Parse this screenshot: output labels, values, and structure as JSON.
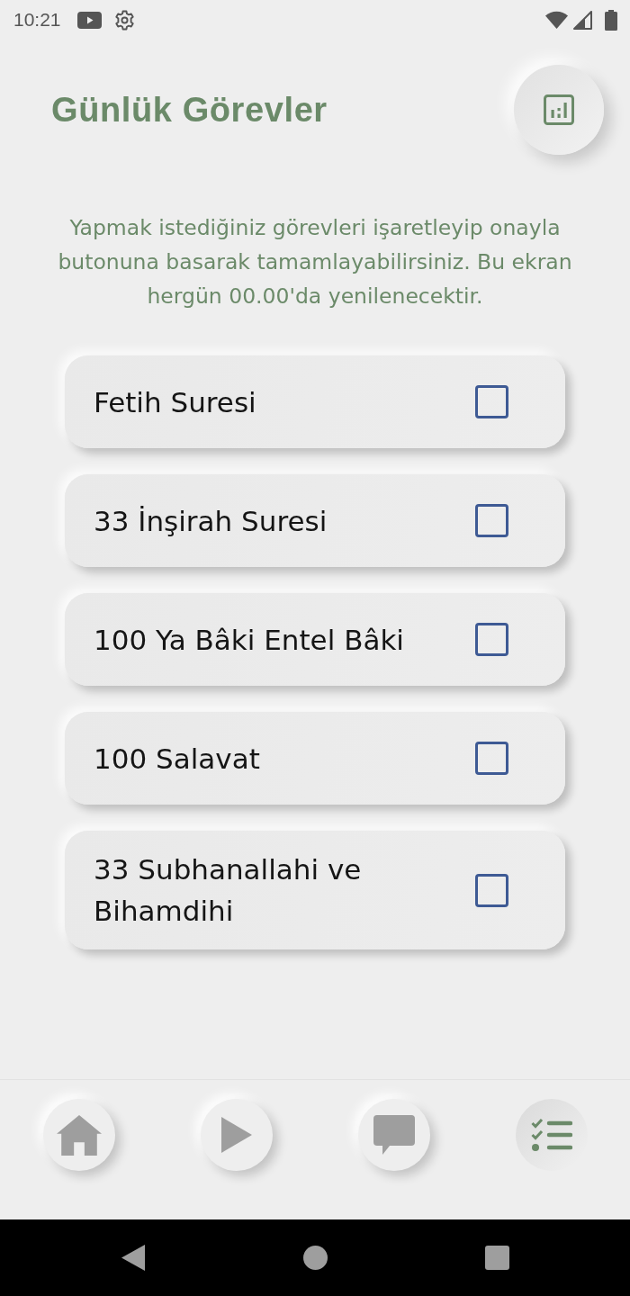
{
  "status_bar": {
    "time": "10:21"
  },
  "header": {
    "title": "Günlük Görevler"
  },
  "description": "Yapmak istediğiniz görevleri işaretleyip onayla butonuna basarak tamamlayabilirsiniz. Bu ekran hergün 00.00'da yenilenecektir.",
  "tasks": [
    {
      "label": "Fetih Suresi",
      "checked": false
    },
    {
      "label": "33 İnşirah Suresi",
      "checked": false
    },
    {
      "label": "100 Ya Bâki Entel Bâki",
      "checked": false
    },
    {
      "label": "100 Salavat",
      "checked": false
    },
    {
      "label": "33 Subhanallahi ve Bihamdihi",
      "checked": false
    }
  ],
  "bottom_nav": [
    {
      "kind": "home",
      "selected": false
    },
    {
      "kind": "play",
      "selected": false
    },
    {
      "kind": "chat",
      "selected": false
    },
    {
      "kind": "tasks",
      "selected": true
    }
  ]
}
